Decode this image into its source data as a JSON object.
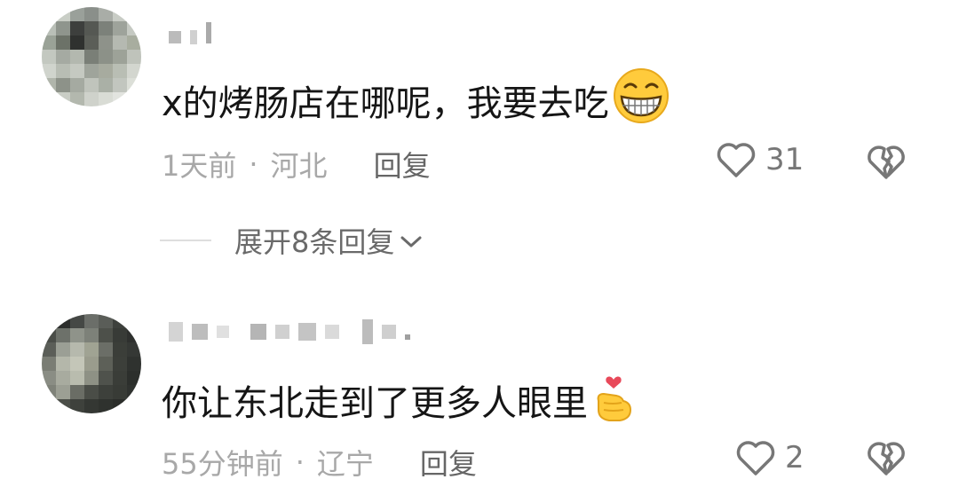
{
  "comments": [
    {
      "text": "x的烤肠店在哪呢，我要去吃",
      "emoji": "grinning-face",
      "time": "1天前",
      "location": "河北",
      "separator": "·",
      "reply_label": "回复",
      "likes": "31"
    },
    {
      "text": "你让东北走到了更多人眼里",
      "emoji": "finger-heart",
      "time": "55分钟前",
      "location": "辽宁",
      "separator": "·",
      "reply_label": "回复",
      "likes": "2"
    }
  ],
  "expand_replies": {
    "label": "展开8条回复"
  },
  "colors": {
    "text": "#151515",
    "meta": "#a8a8a8",
    "reply": "#666666",
    "icon": "#777777"
  }
}
